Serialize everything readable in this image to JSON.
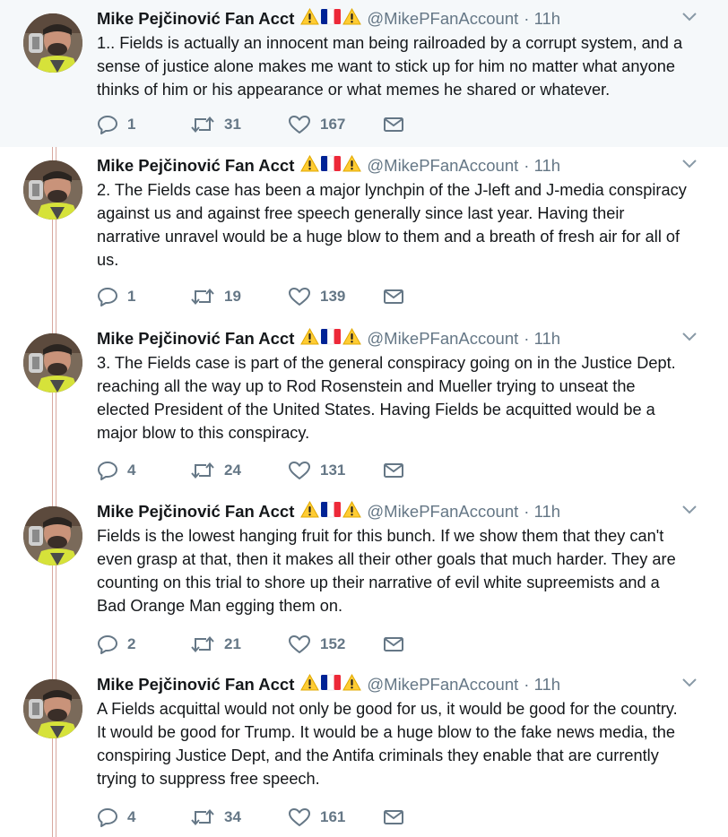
{
  "author": {
    "name": "Mike Pejčinović Fan Acct",
    "handle": "@MikePFanAccount",
    "badge_emojis": [
      "warning-icon",
      "french-flag-icon",
      "warning-icon"
    ],
    "flag_colors": [
      "#002395",
      "#ffffff",
      "#ed2939"
    ]
  },
  "tweets": [
    {
      "time": "· 11h",
      "text": "1.. Fields is actually an innocent man being railroaded by a corrupt system, and a sense of justice alone makes me want to stick up for him no matter what anyone thinks of him or his appearance or what memes he shared or whatever.",
      "replies": "1",
      "retweets": "31",
      "likes": "167"
    },
    {
      "time": "· 11h",
      "text": "2. The Fields case has been a major lynchpin of the J-left and J-media conspiracy against us and against free speech generally since last year. Having their narrative unravel would be a huge blow to them and a breath of fresh air for all of us.",
      "replies": "1",
      "retweets": "19",
      "likes": "139"
    },
    {
      "time": "· 11h",
      "text": "3. The Fields case is part of the general conspiracy going on in the Justice Dept. reaching all the way up to Rod Rosenstein and Mueller trying to unseat the elected President of the United States. Having Fields be acquitted would be a major blow to this conspiracy.",
      "replies": "4",
      "retweets": "24",
      "likes": "131"
    },
    {
      "time": "· 11h",
      "text": "Fields is the lowest hanging fruit for this bunch. If we show them that they can't even grasp at that, then it makes all their other goals that much harder. They are counting on this trial to shore up their narrative of evil white supreemists and a Bad Orange Man egging them on.",
      "replies": "2",
      "retweets": "21",
      "likes": "152"
    },
    {
      "time": "· 11h",
      "text": "A Fields acquittal would not only be good for us, it would be good for the country. It would be good for Trump. It would be a huge blow to the fake news media, the conspiring Justice Dept, and the Antifa criminals they enable that are currently trying to suppress free speech.",
      "replies": "4",
      "retweets": "34",
      "likes": "161"
    }
  ]
}
